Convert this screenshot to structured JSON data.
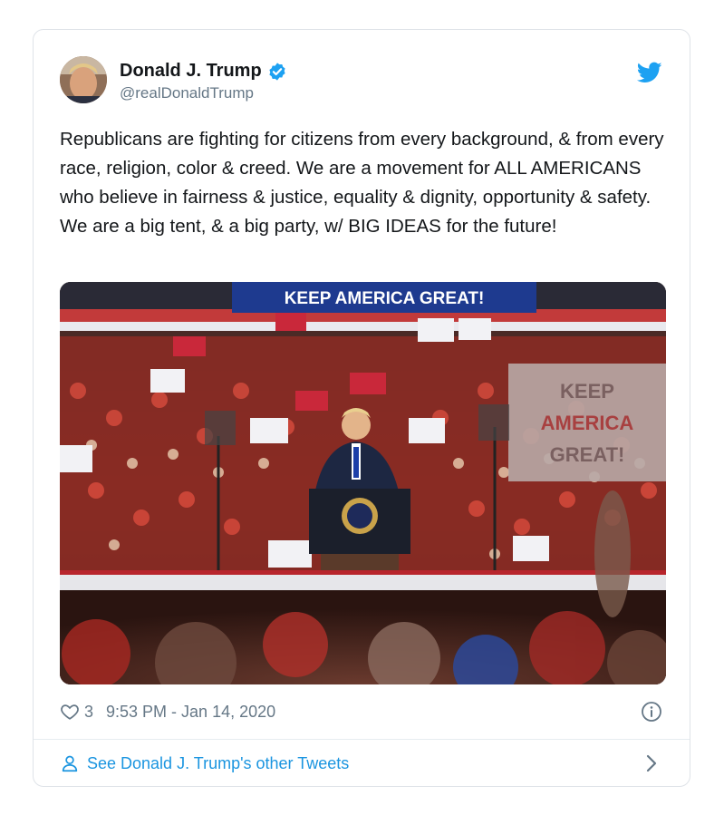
{
  "tweet": {
    "author_name": "Donald J. Trump",
    "handle": "@realDonaldTrump",
    "text": "Republicans are fighting for citizens from every background, & from every race, religion, color & creed. We are a movement for ALL AMERICANS who believe in fairness & justice, equality & dignity, opportunity & safety. We are a big tent, & a big party, w/ BIG IDEAS for the future!",
    "photo": {
      "banner_text": "KEEP AMERICA GREAT!",
      "sign_text": [
        "KEEP",
        "AMERICA",
        "GREAT!"
      ]
    },
    "like_count": "3",
    "timestamp": "9:53 PM - Jan 14, 2020"
  },
  "footer": {
    "other_tweets_label": "See Donald J. Trump's other Tweets"
  },
  "icons": {
    "verified": "verified-badge-icon",
    "bird": "twitter-bird-icon",
    "heart": "heart-icon",
    "info": "info-icon",
    "person": "person-icon",
    "chevron": "chevron-right-icon"
  },
  "colors": {
    "twitter_blue": "#1da1f2",
    "link_blue": "#1b95e0",
    "meta_gray": "#657786"
  }
}
